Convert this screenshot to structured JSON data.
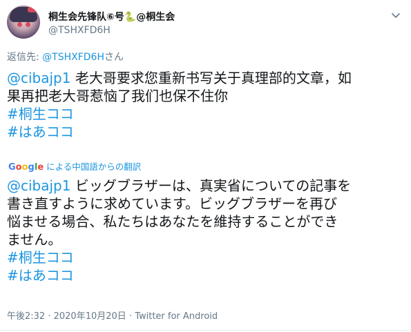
{
  "author": {
    "name": "桐生会先锋队⑥号",
    "emoji": "🐍",
    "name_suffix": "@桐生会",
    "handle": "@TSHXFD6H"
  },
  "reply": {
    "prefix": "返信先: ",
    "target": "@TSHXFD6H",
    "suffix": "さん"
  },
  "original": {
    "mention": "@cibajp1",
    "line1_rest": " 老大哥要求您重新书写关于真理部的文章，如",
    "line2": "果再把老大哥惹恼了我们也保不住你",
    "hashtags": [
      "#桐生ココ",
      "#はあココ"
    ]
  },
  "translation_bar": {
    "brand": "Google",
    "label": "による中国語からの翻訳"
  },
  "translated": {
    "mention": "@cibajp1",
    "line1_rest": " ビッグブラザーは、真実省についての記事を",
    "line2": "書き直すように求めています。ビッグブラザーを再び",
    "line3": "悩ませる場合、私たちはあなたを維持することができ",
    "line4": "ません。",
    "hashtags": [
      "#桐生ココ",
      "#はあココ"
    ]
  },
  "meta": {
    "time": "午後2:32",
    "sep": " · ",
    "date": "2020年10月20日",
    "client": "Twitter for Android"
  },
  "icons": {
    "caret": "chevron-down-icon",
    "avatar": "avatar"
  },
  "colors": {
    "link": "#1b95e0",
    "secondary": "#657786",
    "text": "#14171a"
  }
}
